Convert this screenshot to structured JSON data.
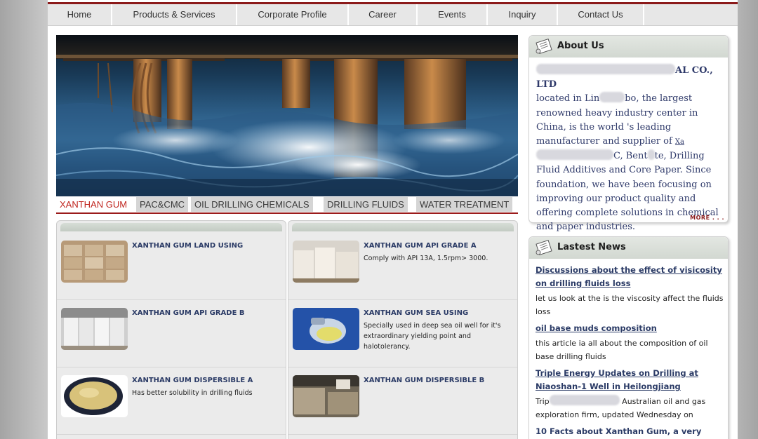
{
  "nav": [
    {
      "label": "Home"
    },
    {
      "label": "Products & Services"
    },
    {
      "label": "Corporate Profile"
    },
    {
      "label": "Career"
    },
    {
      "label": "Events"
    },
    {
      "label": "Inquiry"
    },
    {
      "label": "Contact Us"
    }
  ],
  "tabs": [
    {
      "label": "XANTHAN GUM",
      "active": true
    },
    {
      "label": "PAC&CMC"
    },
    {
      "label": "OIL DRILLING CHEMICALS"
    },
    {
      "label": "DRILLING FLUIDS"
    },
    {
      "label": "WATER TREATMENT"
    }
  ],
  "products": {
    "left": [
      {
        "title": "XANTHAN GUM LAND USING",
        "desc": ""
      },
      {
        "title": "XANTHAN GUM API GRADE B",
        "desc": ""
      },
      {
        "title": "XANTHAN GUM DISPERSIBLE A",
        "desc": "Has better solubility in drilling fluids"
      }
    ],
    "right": [
      {
        "title": "XANTHAN GUM API GRADE A",
        "desc": "Comply with API 13A, 1.5rpm> 3000."
      },
      {
        "title": "XANTHAN GUM SEA USING",
        "desc": "Specially used in deep sea oil well for it's extraordinary yielding point and halotolerancy."
      },
      {
        "title": "XANTHAN GUM DISPERSIBLE B",
        "desc": ""
      }
    ]
  },
  "about": {
    "title": "About Us",
    "company_suffix": "AL CO., LTD",
    "line1_a": "located in Lin",
    "line1_b": "bo, the largest renowned heavy industry center in China, is the world 's leading manufacturer and supplier of ",
    "link_start": "Xa",
    "line2_a": "C, Bent",
    "line2_b": "te, Drilling Fluid Additives and Core Paper. Since foundation, we have been focusing on improving our product quality and offering complete solutions in chemical and paper industries.",
    "more": "MORE . . ."
  },
  "news": {
    "title": "Lastest News",
    "items": [
      {
        "title": "Discussions about the effect of visicosity on drilling fluids loss",
        "desc": "let us look at the is the viscosity affect the fluids loss"
      },
      {
        "title": "oil base muds composition",
        "desc": "this article ia all about the composition of oil base drilling fluids"
      },
      {
        "title": "Triple Energy Updates on Drilling at Niaoshan-1 Well in Heilongjiang",
        "desc_start": "Trip",
        "desc_end": "Australian oil and gas exploration firm, updated Wednesday on"
      },
      {
        "title": "10 Facts about Xanthan Gum, a very"
      }
    ]
  }
}
